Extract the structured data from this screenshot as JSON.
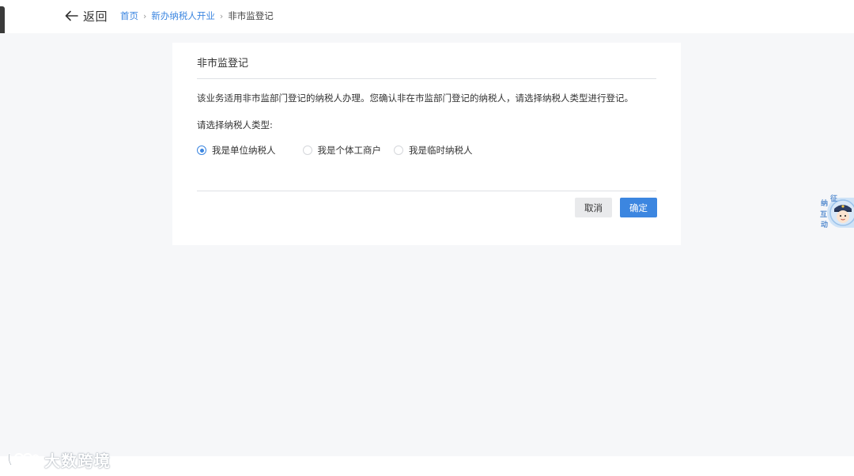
{
  "header": {
    "back_label": "返回",
    "breadcrumb": {
      "home": "首页",
      "parent": "新办纳税人开业",
      "current": "非市监登记",
      "separator": "›"
    }
  },
  "form": {
    "title": "非市监登记",
    "description": "该业务适用非市监部门登记的纳税人办理。您确认非在市监部门登记的纳税人，请选择纳税人类型进行登记。",
    "type_label": "请选择纳税人类型:",
    "options": [
      {
        "label": "我是单位纳税人",
        "checked": true
      },
      {
        "label": "我是个体工商户",
        "checked": false
      },
      {
        "label": "我是临时纳税人",
        "checked": false
      }
    ],
    "cancel_label": "取消",
    "confirm_label": "确定"
  },
  "assistant": {
    "chars": [
      "征",
      "纳",
      "互",
      "动"
    ]
  },
  "watermark": {
    "text": "大数跨境"
  },
  "colors": {
    "accent": "#3c86e0",
    "page_bg": "#f6f7f9",
    "cancel_bg": "#e9eaec"
  }
}
